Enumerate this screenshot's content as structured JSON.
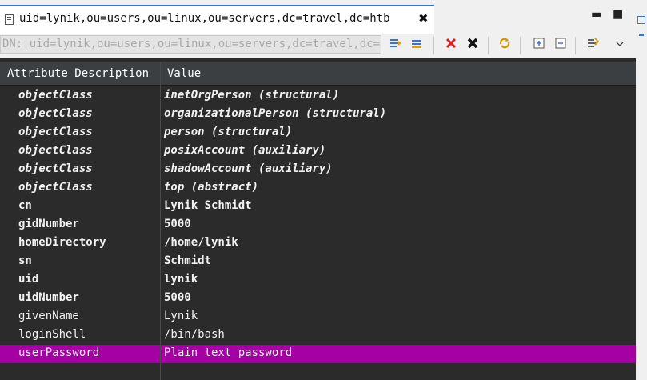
{
  "tab": {
    "title": "uid=lynik,ou=users,ou=linux,ou=servers,dc=travel,dc=htb",
    "close_glyph": "✖"
  },
  "window": {
    "minimize_glyph": "▬",
    "maximize_glyph": "■"
  },
  "dn_bar": {
    "value": "DN: uid=lynik,ou=users,ou=linux,ou=servers,dc=travel,dc=htb"
  },
  "toolbar_icons": [
    "new-value-icon",
    "new-attribute-icon",
    "delete-icon",
    "delete-all-icon",
    "refresh-icon",
    "expand-all-icon",
    "collapse-all-icon",
    "show-decorated-values-icon",
    "view-menu-icon"
  ],
  "table": {
    "headers": [
      "Attribute Description",
      "Value"
    ],
    "rows": [
      {
        "attr": "objectClass",
        "value": "inetOrgPerson (structural)",
        "style": "bold-italic"
      },
      {
        "attr": "objectClass",
        "value": "organizationalPerson (structural)",
        "style": "bold-italic"
      },
      {
        "attr": "objectClass",
        "value": "person (structural)",
        "style": "bold-italic"
      },
      {
        "attr": "objectClass",
        "value": "posixAccount (auxiliary)",
        "style": "bold-italic"
      },
      {
        "attr": "objectClass",
        "value": "shadowAccount (auxiliary)",
        "style": "bold-italic"
      },
      {
        "attr": "objectClass",
        "value": "top (abstract)",
        "style": "bold-italic"
      },
      {
        "attr": "cn",
        "value": "Lynik Schmidt",
        "style": "bold"
      },
      {
        "attr": "gidNumber",
        "value": "5000",
        "style": "bold"
      },
      {
        "attr": "homeDirectory",
        "value": "/home/lynik",
        "style": "bold"
      },
      {
        "attr": "sn",
        "value": "Schmidt",
        "style": "bold"
      },
      {
        "attr": "uid",
        "value": "lynik",
        "style": "bold"
      },
      {
        "attr": "uidNumber",
        "value": "5000",
        "style": "bold"
      },
      {
        "attr": "givenName",
        "value": "Lynik",
        "style": "normal"
      },
      {
        "attr": "loginShell",
        "value": "/bin/bash",
        "style": "normal"
      },
      {
        "attr": "userPassword",
        "value": "Plain text password",
        "style": "normal",
        "selected": true
      }
    ]
  },
  "colors": {
    "selection": "#a400a4",
    "table_background": "#2b2b2b",
    "header_background": "#3c3f41",
    "tab_accent": "#3874d8"
  }
}
